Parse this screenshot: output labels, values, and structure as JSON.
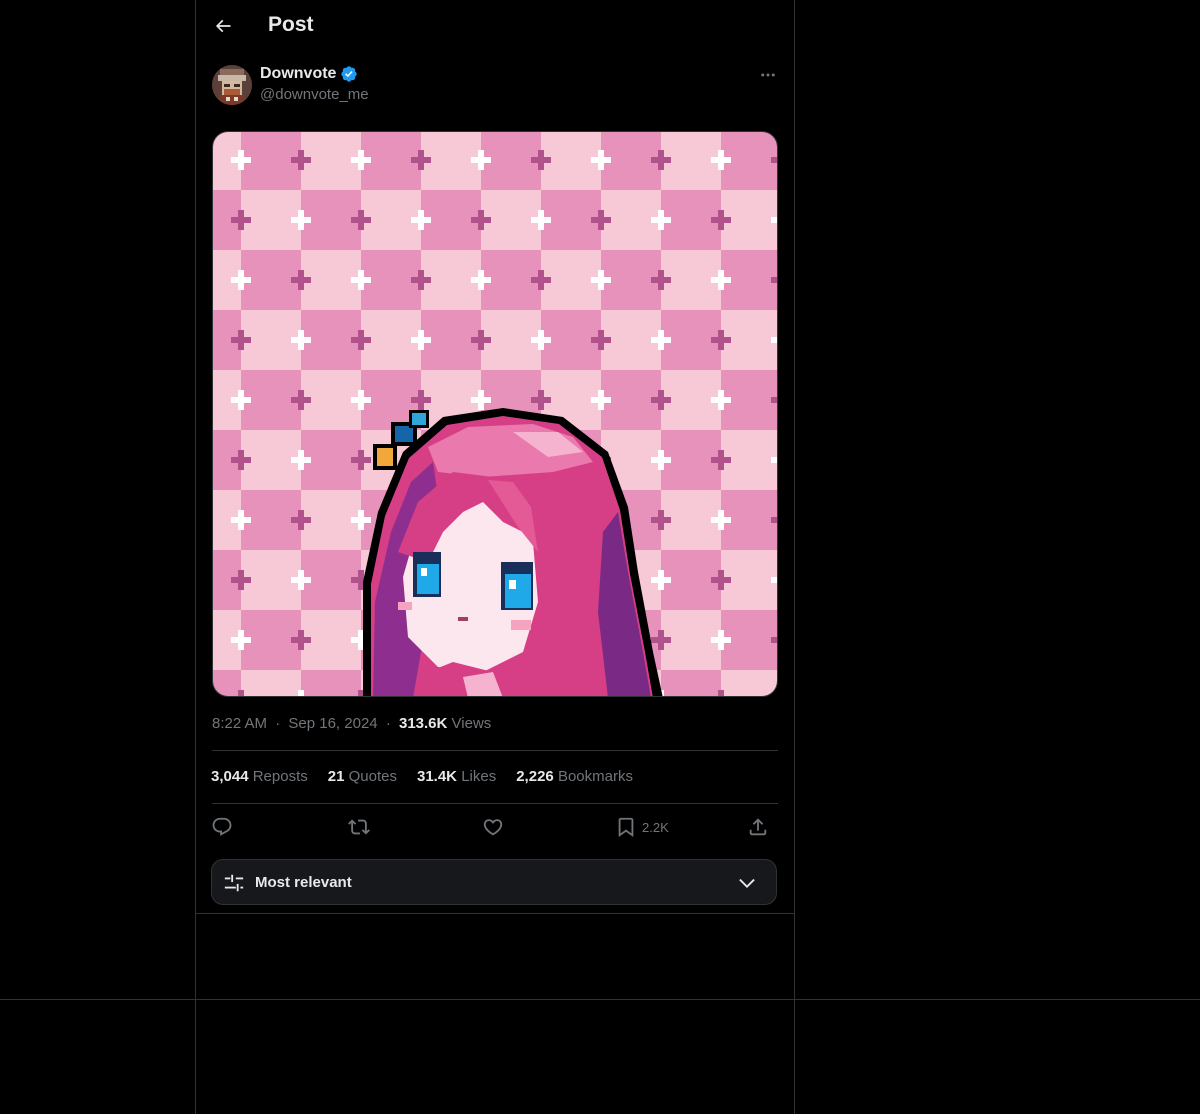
{
  "header": {
    "title": "Post"
  },
  "post": {
    "author_name": "Downvote",
    "author_handle": "@downvote_me",
    "time": "8:22 AM",
    "date": "Sep 16, 2024",
    "views_count": "313.6K",
    "views_label": "Views",
    "separator": "·"
  },
  "stats": {
    "reposts_count": "3,044",
    "reposts_label": "Reposts",
    "quotes_count": "21",
    "quotes_label": "Quotes",
    "likes_count": "31.4K",
    "likes_label": "Likes",
    "bookmarks_count": "2,226",
    "bookmarks_label": "Bookmarks"
  },
  "actions": {
    "bookmark_count": "2.2K"
  },
  "sort": {
    "label": "Most relevant"
  },
  "colors": {
    "background": "#000000",
    "border": "#2f3336",
    "text_primary": "#e7e9ea",
    "text_secondary": "#71767b",
    "verified": "#1d9bf0",
    "sort_bg": "#16181c"
  },
  "icons": {
    "back": "arrow-left-icon",
    "verified": "verified-badge-icon",
    "more": "more-horizontal-icon",
    "reply": "reply-icon",
    "repost": "repost-icon",
    "like": "heart-icon",
    "bookmark": "bookmark-icon",
    "share": "share-icon",
    "sort": "sliders-icon",
    "chevron": "chevron-down-icon"
  }
}
